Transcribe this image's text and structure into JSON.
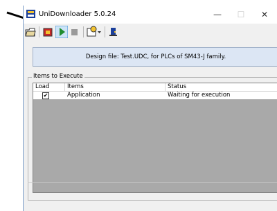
{
  "window": {
    "title": "UniDownloader 5.0.24",
    "controls": {
      "minimize": "—",
      "maximize": "☐",
      "close": "✕"
    }
  },
  "toolbar": {
    "buttons": [
      {
        "icon": "open-folder-icon"
      },
      {
        "icon": "download-icon"
      },
      {
        "icon": "play-icon"
      },
      {
        "icon": "stop-icon"
      },
      {
        "icon": "settings-dropdown-icon"
      },
      {
        "icon": "exit-icon"
      }
    ]
  },
  "banner": {
    "text": "Design file: Test.UDC, for PLCs of SM43-J family."
  },
  "items_group": {
    "label": "Items to Execute",
    "columns": [
      "Load",
      "Items",
      "Status"
    ],
    "rows": [
      {
        "load": true,
        "item": "Application",
        "status": "Waiting for execution"
      }
    ]
  },
  "colors": {
    "accent": "#1e8c2e",
    "list_bg": "#a9a9a9",
    "banner_bg": "#dce6f4"
  }
}
